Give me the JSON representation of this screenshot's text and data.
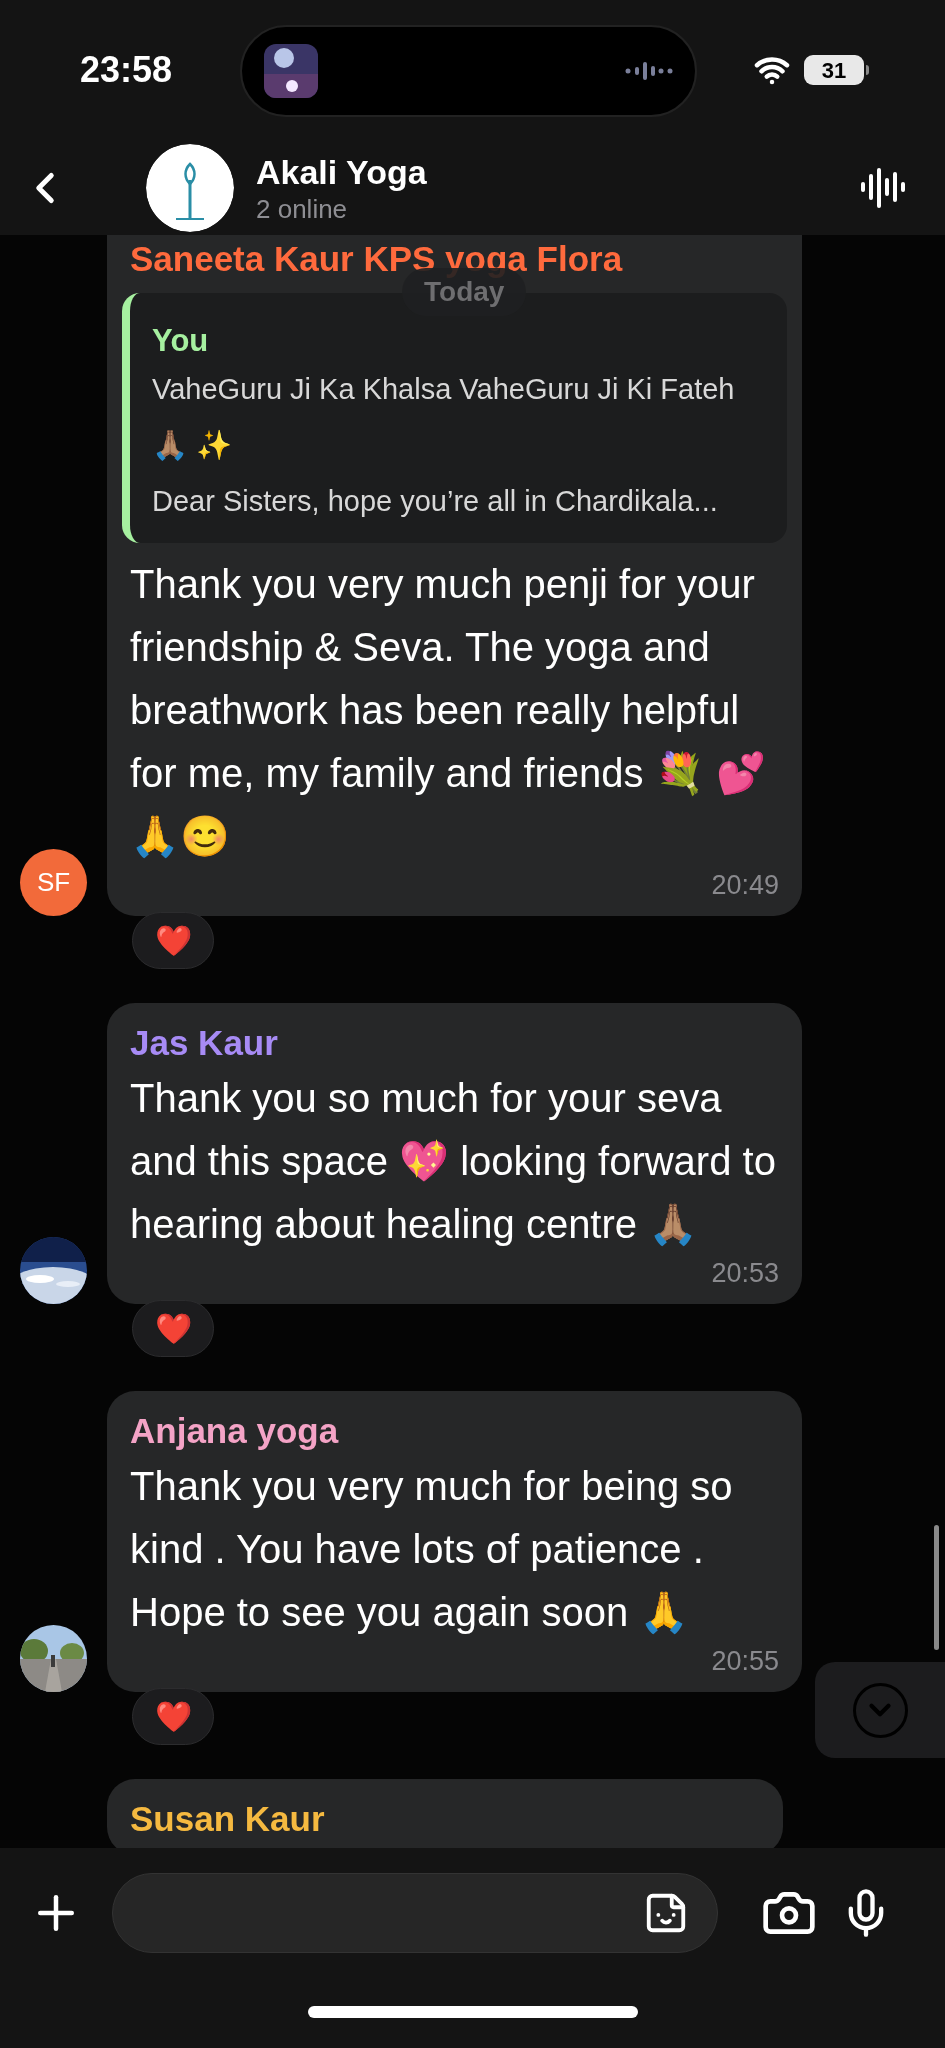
{
  "status_bar": {
    "time": "23:58",
    "battery": "31"
  },
  "header": {
    "title": "Akali Yoga",
    "subtitle": "2 online"
  },
  "date_badge": "Today",
  "messages": [
    {
      "sender": "Saneeta Kaur KPS yoga Flora",
      "color": "#ff6a3d",
      "avatar": {
        "kind": "initials",
        "text": "SF",
        "color": "#f26a3a"
      },
      "reply": {
        "sender": "You",
        "color": "#a6f0a0",
        "lines": [
          "VaheGuru Ji Ka Khalsa VaheGuru Ji Ki Fateh 🙏🏽 ✨",
          "Dear Sisters, hope you’re all in Chardikala..."
        ]
      },
      "text": "Thank you very much penji for your friendship & Seva. The yoga and breathwork has been really helpful for me, my family and friends 💐 💕🙏😊",
      "time": "20:49",
      "reactions": [
        "❤️"
      ]
    },
    {
      "sender": "Jas Kaur",
      "color": "#a78bf5",
      "avatar": {
        "kind": "picture"
      },
      "text": "Thank you so much for your seva and this space 💖 looking forward to hearing about healing centre 🙏🏽",
      "time": "20:53",
      "reactions": [
        "❤️"
      ]
    },
    {
      "sender": "Anjana yoga",
      "color": "#f4a3c6",
      "avatar": {
        "kind": "picture"
      },
      "text": "Thank you very much for being so kind . You have lots of patience . Hope to see you again soon 🙏",
      "time": "20:55",
      "reactions": [
        "❤️"
      ]
    },
    {
      "sender": "Susan Kaur",
      "color": "#f5b940"
    }
  ]
}
